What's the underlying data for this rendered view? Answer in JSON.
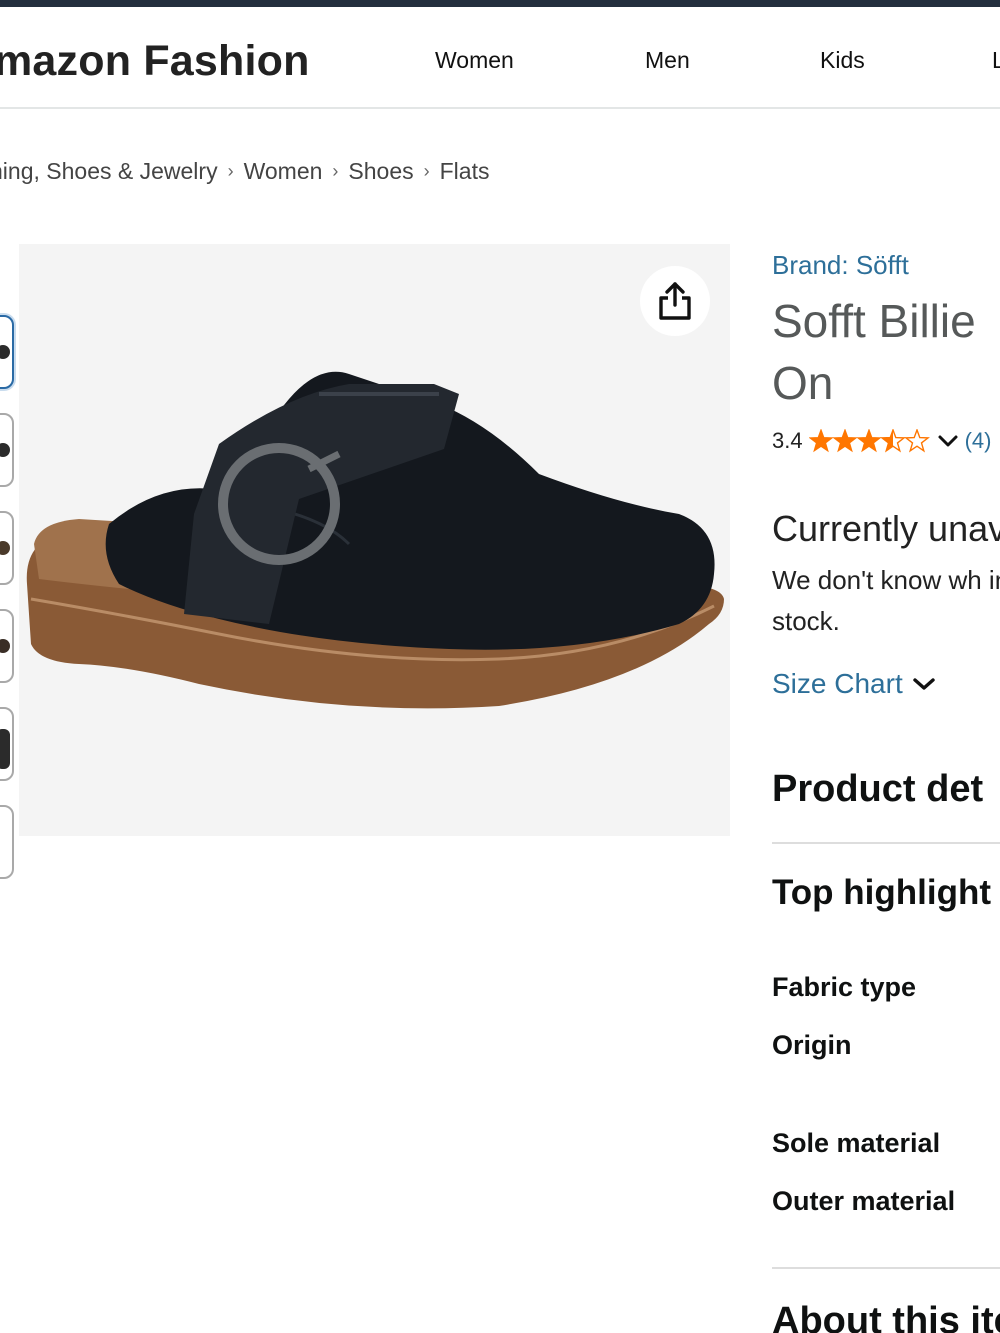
{
  "header": {
    "logo_text": "mazon Fashion",
    "nav": [
      "Women",
      "Men",
      "Kids",
      "L"
    ]
  },
  "breadcrumb": {
    "items": [
      "hing, Shoes & Jewelry",
      "Women",
      "Shoes",
      "Flats"
    ],
    "separator": "›"
  },
  "gallery": {
    "thumbnail_count": 6,
    "main_image": "black suede clog with buckle strap"
  },
  "product": {
    "brand": "Brand: Söfft",
    "title_line1": "Sofft Billie",
    "title_line2": "On",
    "rating_value": "3.4",
    "rating_count": "(4)",
    "stars_filled": 3.5,
    "availability": "Currently unav",
    "stock_note": "We don't know wh in stock.",
    "size_chart": "Size Chart"
  },
  "details": {
    "heading": "Product det",
    "top_highlights": "Top highlight",
    "specs": [
      "Fabric type",
      "Origin",
      "Sole material",
      "Outer material"
    ],
    "about": "About this ite"
  },
  "colors": {
    "link": "#2d6f99",
    "star": "#ff7600",
    "topbar": "#232f3e"
  }
}
